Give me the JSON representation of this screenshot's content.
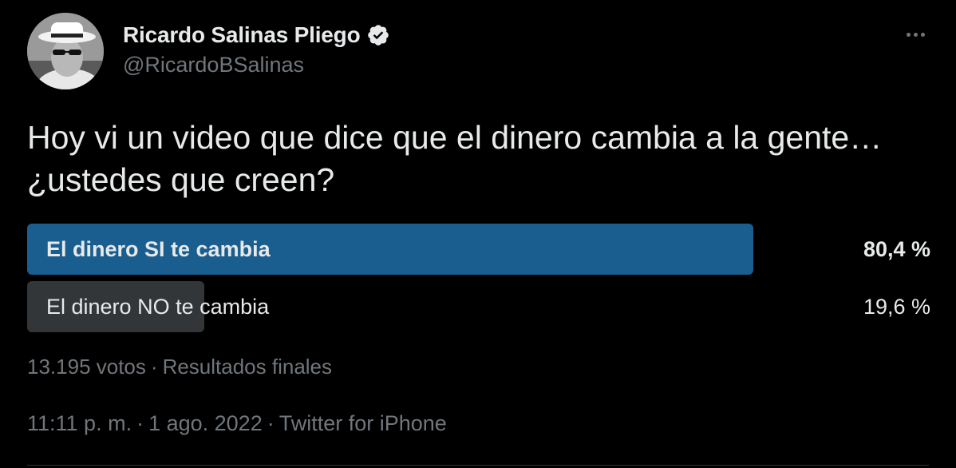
{
  "author": {
    "name": "Ricardo Salinas Pliego",
    "handle": "@RicardoBSalinas",
    "verified_icon": "verified-badge-icon"
  },
  "tweet_text": "Hoy vi un video que dice que el dinero cambia a la gente… ¿ustedes que creen?",
  "poll": {
    "options": [
      {
        "label": "El dinero SI te cambia",
        "percent": "80,4 %",
        "fraction": 0.804,
        "winner": true
      },
      {
        "label": "El dinero NO te cambia",
        "percent": "19,6 %",
        "fraction": 0.196,
        "winner": false
      }
    ],
    "votes": "13.195 votos",
    "status": "Resultados finales"
  },
  "meta": {
    "time": "11:11 p. m.",
    "date": "1 ago. 2022",
    "source": "Twitter for iPhone"
  },
  "colors": {
    "background": "#000000",
    "text": "#e7e9ea",
    "muted": "#71767b",
    "poll_winner": "#1a5e8f",
    "poll_other": "#333639"
  }
}
